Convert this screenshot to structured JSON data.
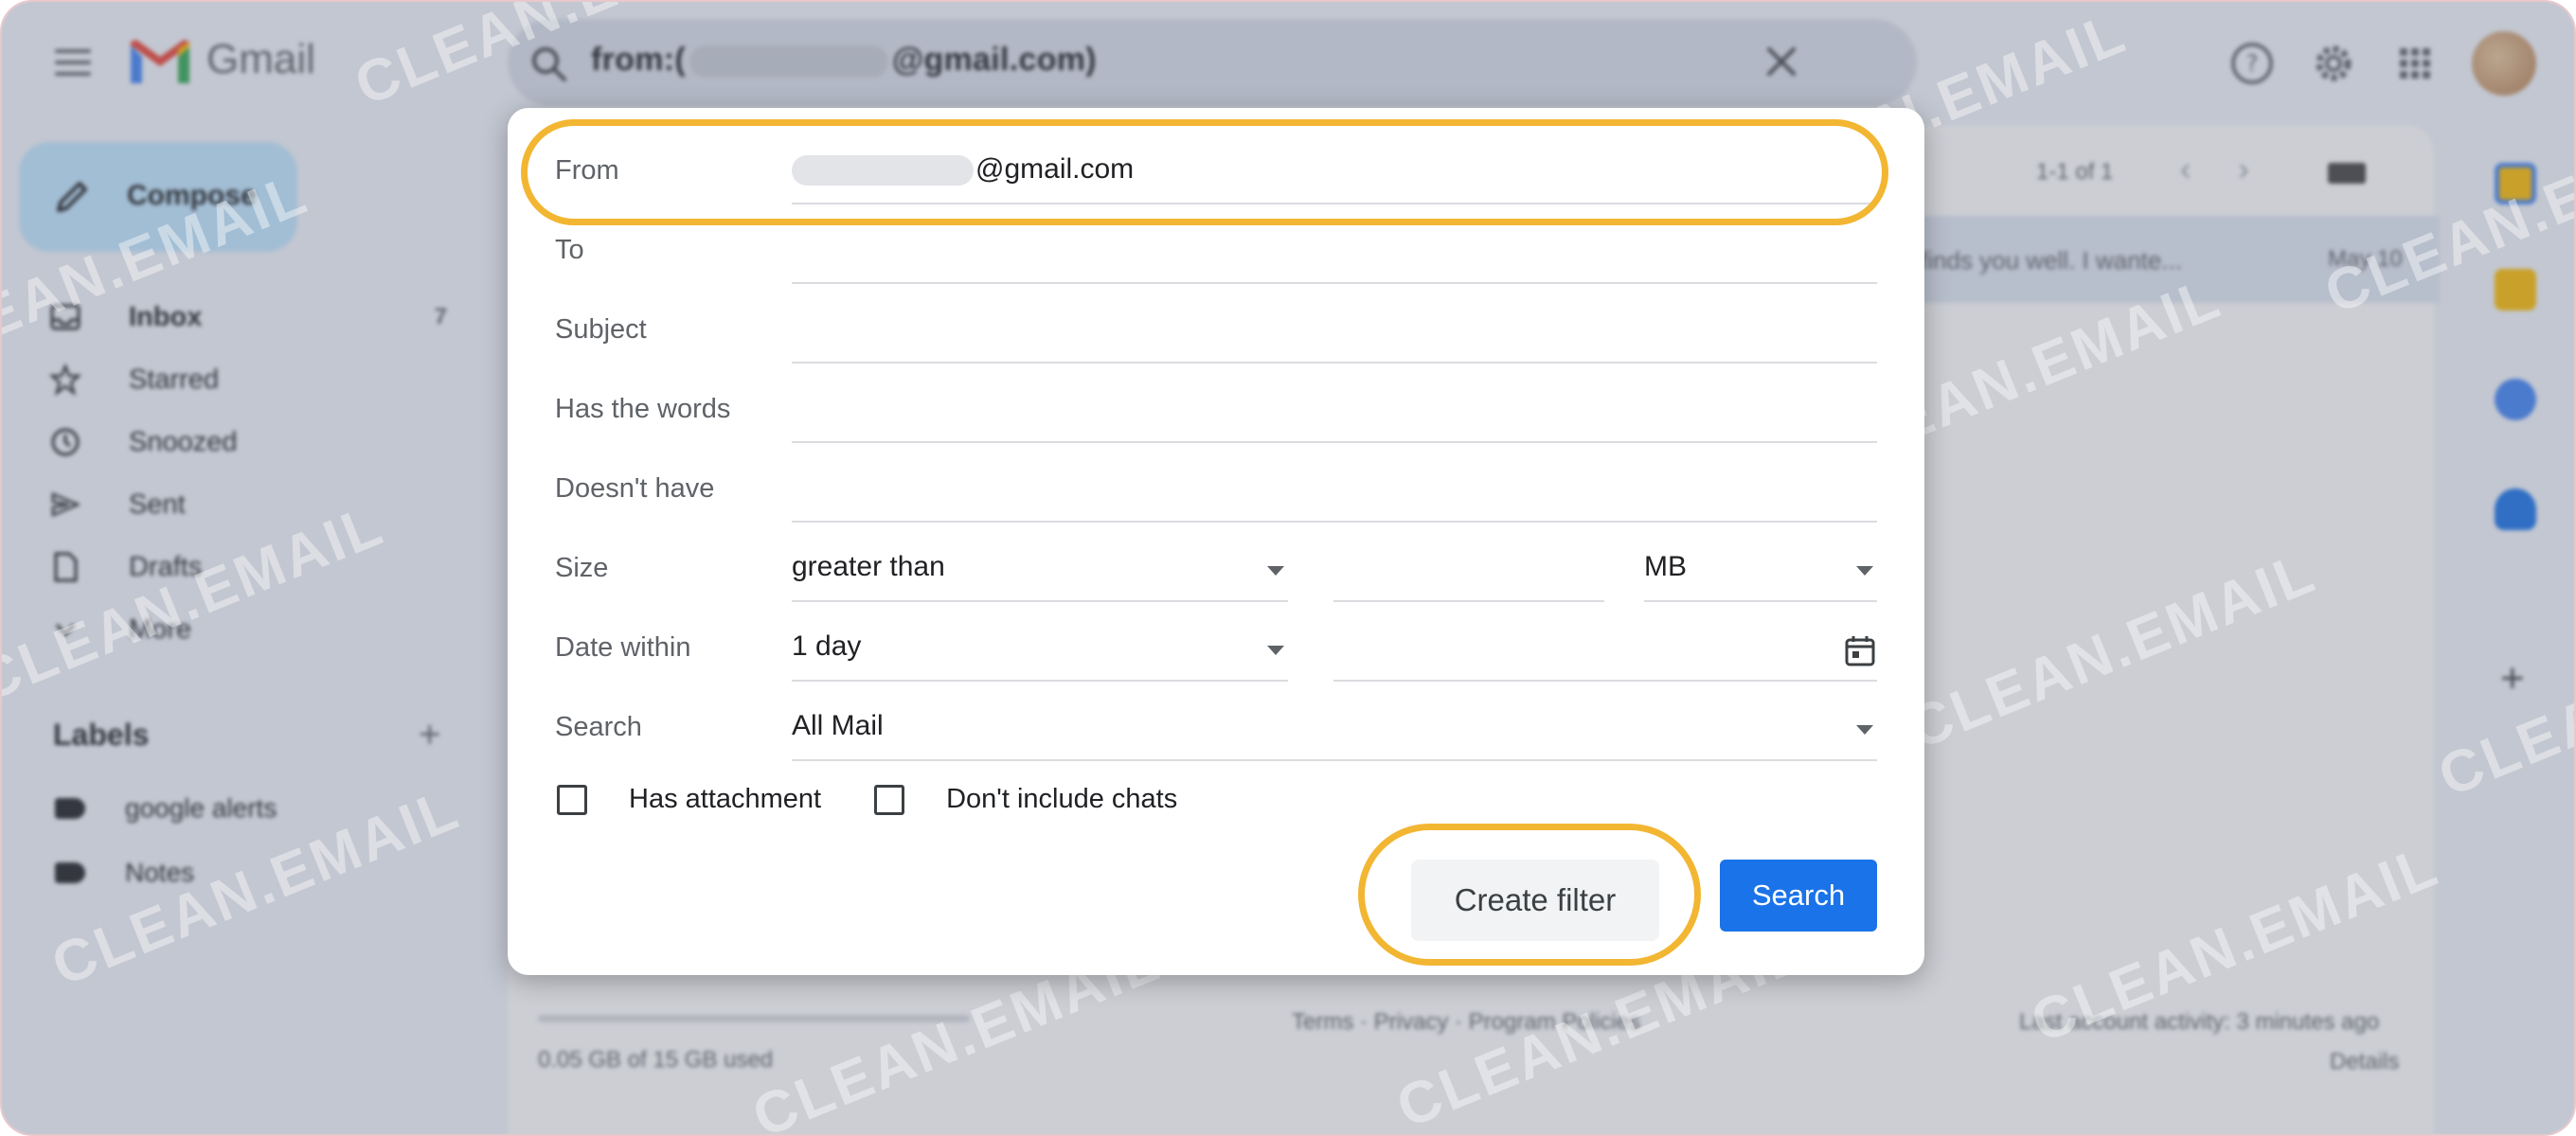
{
  "app": {
    "logo_text": "Gmail"
  },
  "search": {
    "query_prefix": "from:(",
    "query_suffix": "@gmail.com)"
  },
  "sidebar": {
    "compose_label": "Compose",
    "items": [
      {
        "label": "Inbox",
        "count": "7",
        "icon": "inbox-icon"
      },
      {
        "label": "Starred",
        "icon": "star-icon"
      },
      {
        "label": "Snoozed",
        "icon": "clock-icon"
      },
      {
        "label": "Sent",
        "icon": "send-icon"
      },
      {
        "label": "Drafts",
        "icon": "file-icon"
      },
      {
        "label": "More",
        "icon": "chevron-down-icon"
      }
    ],
    "labels_heading": "Labels",
    "labels": [
      {
        "label": "google alerts"
      },
      {
        "label": "Notes"
      }
    ]
  },
  "mail": {
    "pager": "1-1 of 1",
    "snippet": "finds you well. I wante...",
    "date": "May 10",
    "storage": "0.05 GB of 15 GB used",
    "footer_links": "Terms · Privacy · Program Policies",
    "activity": "Last account activity: 3 minutes ago",
    "details": "Details"
  },
  "watermark": "CLEAN.EMAIL",
  "filter": {
    "from_label": "From",
    "from_value": "@gmail.com",
    "to_label": "To",
    "subject_label": "Subject",
    "has_words_label": "Has the words",
    "doesnt_have_label": "Doesn't have",
    "size_label": "Size",
    "size_operator": "greater than",
    "size_unit": "MB",
    "date_label": "Date within",
    "date_value": "1 day",
    "search_label": "Search",
    "search_value": "All Mail",
    "has_attachment": "Has attachment",
    "dont_include_chats": "Don't include chats",
    "create_filter": "Create filter",
    "search_button": "Search"
  },
  "colors": {
    "highlight": "#f2b632",
    "primary_button": "#1a73e8",
    "compose": "#c2e7ff"
  }
}
